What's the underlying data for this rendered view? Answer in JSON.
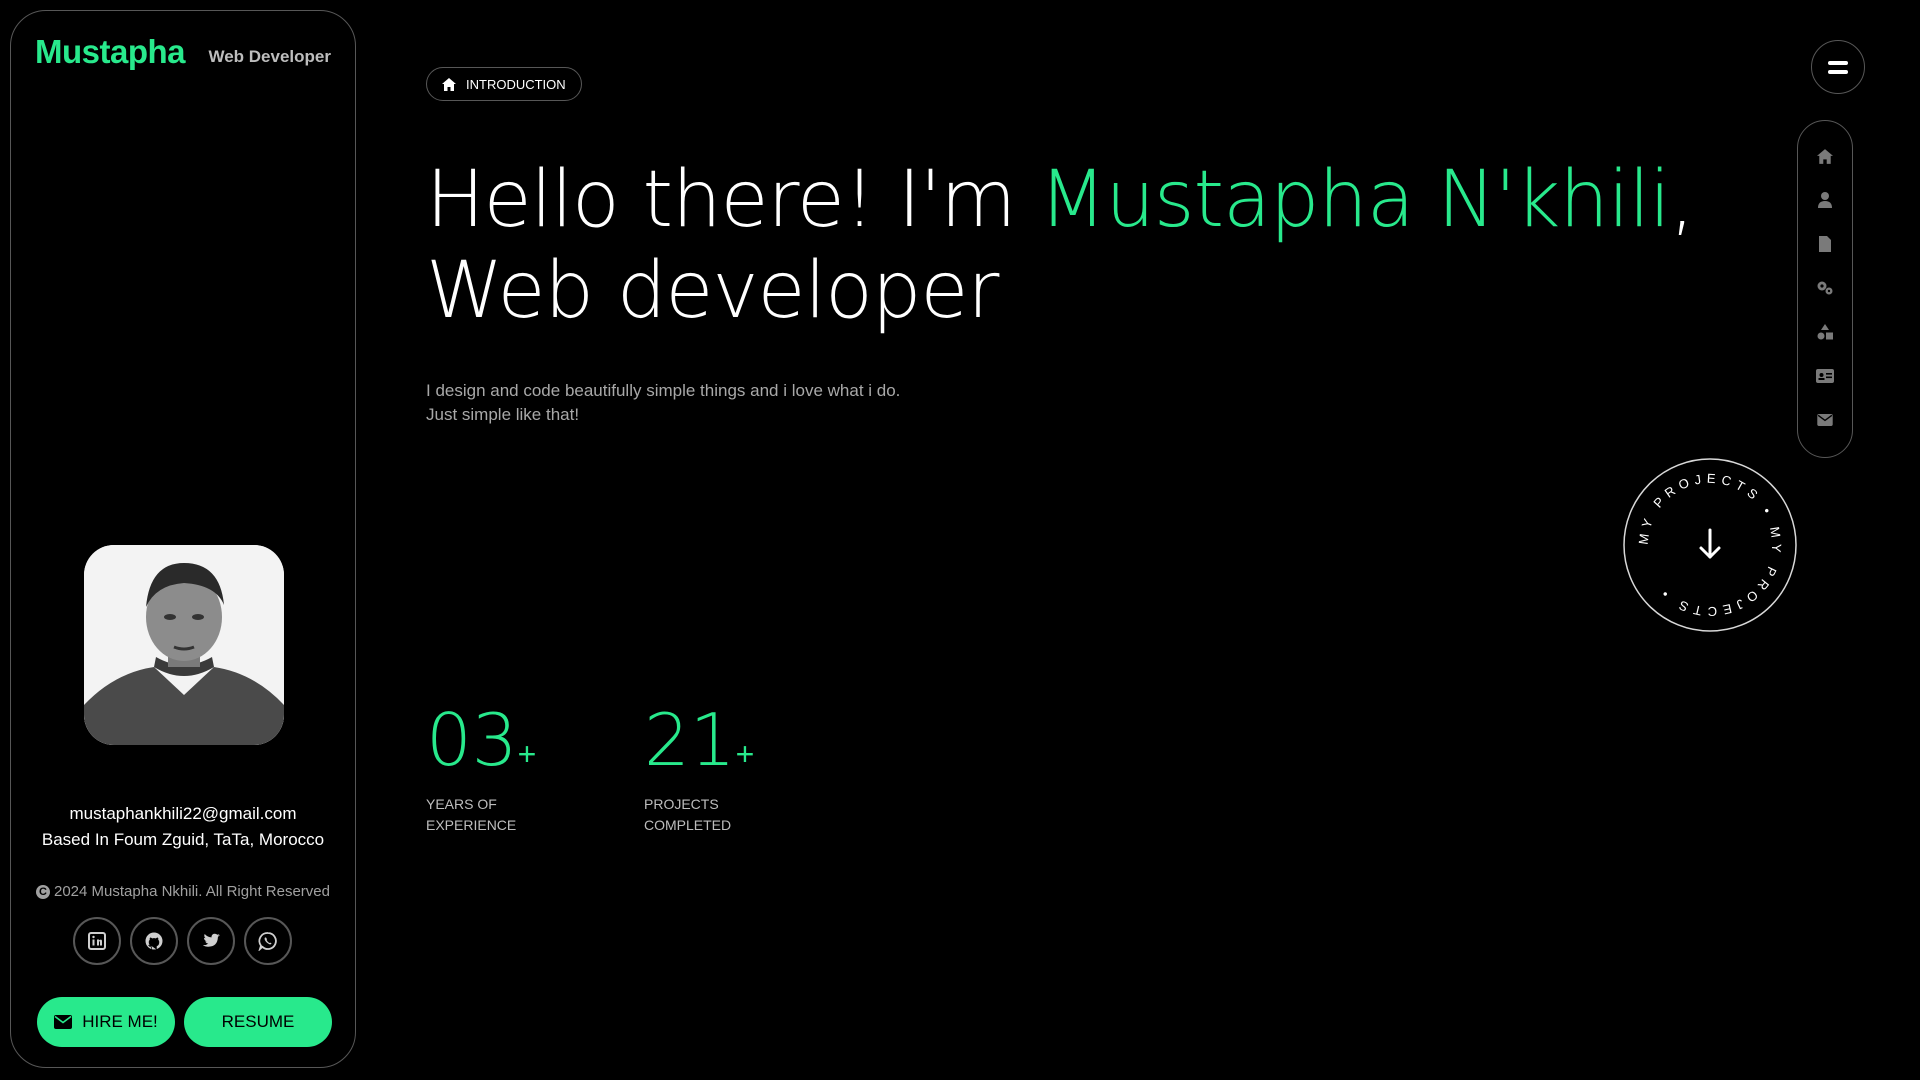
{
  "sidebar": {
    "brand": "Mustapha",
    "role": "Web Developer",
    "email": "mustaphankhili22@gmail.com",
    "location": "Based In Foum Zguid, TaTa, Morocco",
    "copyright": "2024 Mustapha Nkhili. All Right Reserved",
    "socials": [
      "linkedin-icon",
      "github-icon",
      "twitter-icon",
      "whatsapp-icon"
    ],
    "hire_label": "HIRE ME!",
    "resume_label": "RESUME"
  },
  "main": {
    "badge": "INTRODUCTION",
    "headline_pre": "Hello there! I'm ",
    "headline_name": "Mustapha N'khili",
    "headline_post": ", Web developer",
    "tagline_line1": "I design and code beautifully simple things and i love what i do.",
    "tagline_line2": "Just simple like that!",
    "stats": [
      {
        "value": "03",
        "suffix": "+",
        "label_line1": "YEARS OF",
        "label_line2": "EXPERIENCE"
      },
      {
        "value": "21",
        "suffix": "+",
        "label_line1": "PROJECTS",
        "label_line2": "COMPLETED"
      }
    ]
  },
  "nav": {
    "rail_items": [
      "home-icon",
      "user-icon",
      "file-icon",
      "gears-icon",
      "shapes-icon",
      "id-card-icon",
      "envelope-icon"
    ]
  },
  "projects_badge": {
    "ring_text": "MY PROJECTS • MY PROJECTS •"
  },
  "colors": {
    "accent": "#28e98c",
    "background": "#000000",
    "border": "#575757",
    "muted": "#a8a8a8"
  }
}
